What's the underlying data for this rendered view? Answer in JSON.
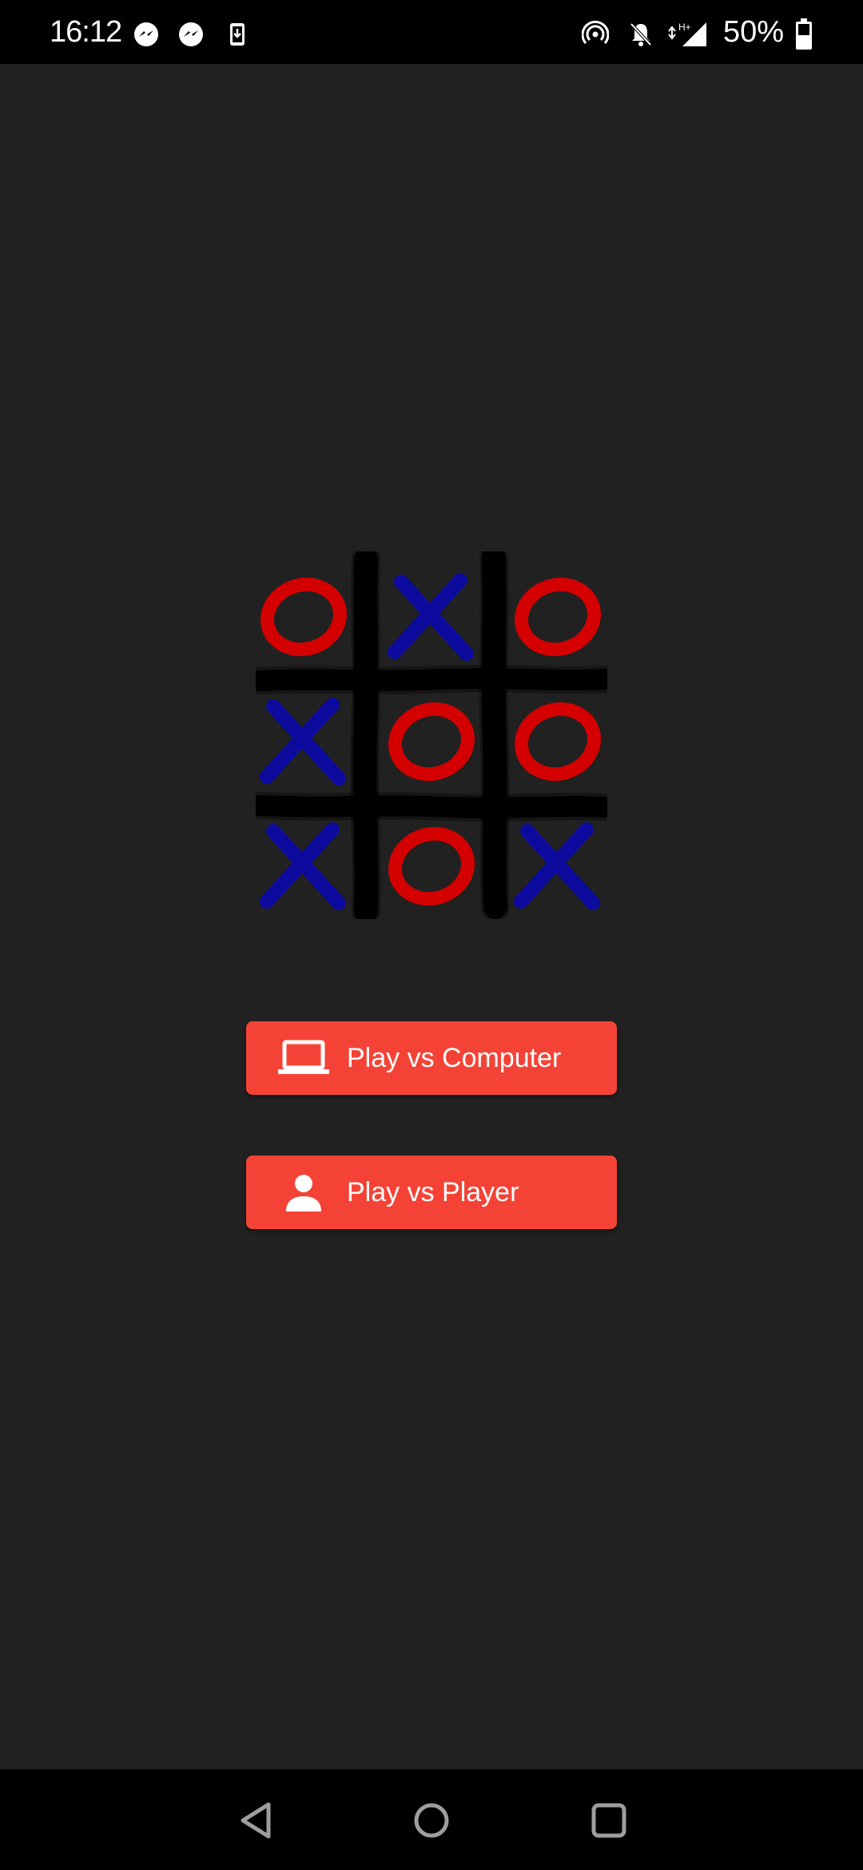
{
  "status_bar": {
    "time": "16:12",
    "battery": "50%",
    "left_icons": [
      "messenger-icon",
      "messenger-icon",
      "download-icon"
    ],
    "right_icons": [
      "hotspot-icon",
      "notifications-off-icon",
      "signal-icon",
      "battery-icon"
    ]
  },
  "logo": {
    "board": [
      [
        "O",
        "X",
        "O"
      ],
      [
        "X",
        "O",
        "O"
      ],
      [
        "X",
        "O",
        "X"
      ]
    ],
    "x_color": "#0d0b9e",
    "o_color": "#d40000",
    "grid_color": "#000000"
  },
  "buttons": {
    "computer": {
      "label": "Play vs Computer",
      "icon": "laptop-icon"
    },
    "player": {
      "label": "Play vs Player",
      "icon": "person-icon"
    },
    "color": "#f44336"
  },
  "nav_bar": {
    "icons": [
      "back-icon",
      "home-icon",
      "recents-icon"
    ]
  }
}
